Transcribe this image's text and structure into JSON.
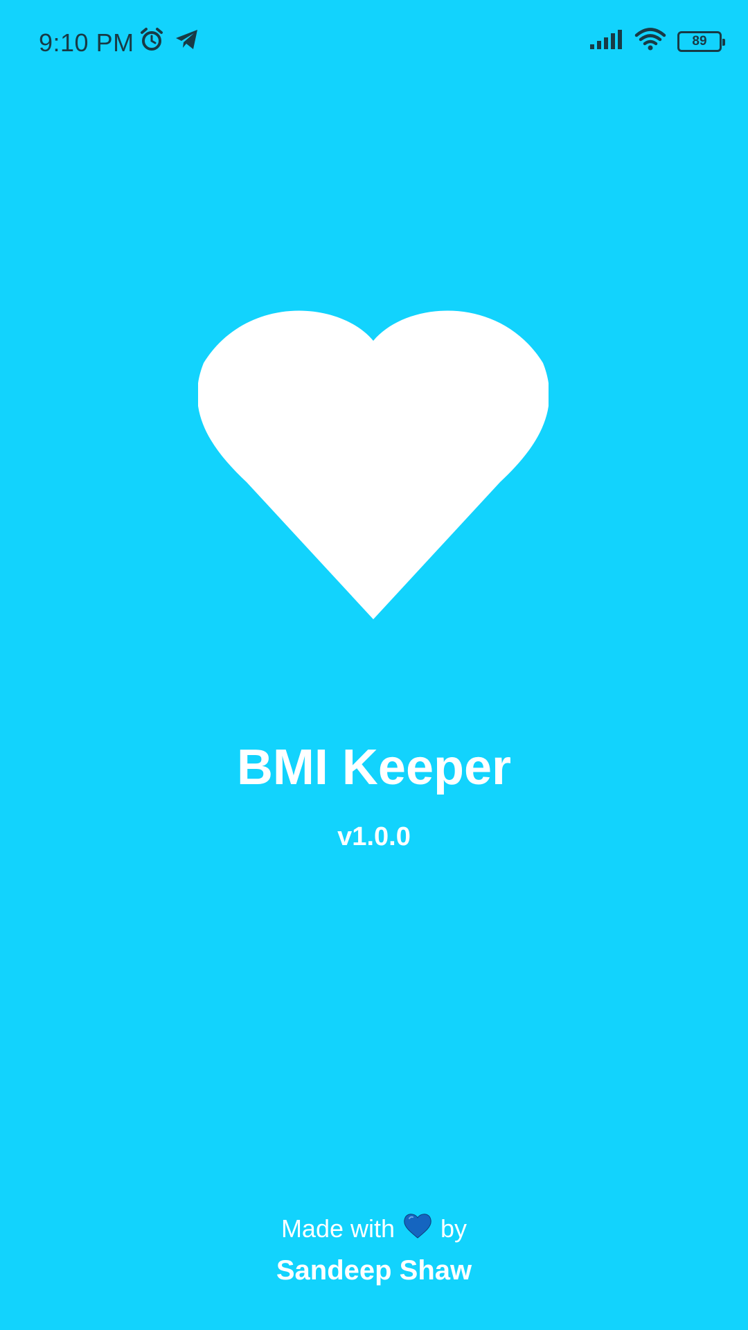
{
  "status_bar": {
    "time": "9:10 PM",
    "battery_level": "89",
    "icons": [
      "alarm-icon",
      "telegram-icon",
      "signal-icon",
      "wifi-icon",
      "battery-icon"
    ]
  },
  "app": {
    "logo_icon": "heart-icon",
    "title": "BMI Keeper",
    "version": "v1.0.0"
  },
  "credits": {
    "made_with_prefix": "Made with",
    "heart_icon": "blue-heart-icon",
    "made_with_suffix": "by",
    "author": "Sandeep Shaw"
  },
  "colors": {
    "background": "#12D3FD",
    "foreground": "#FFFFFF",
    "status_icons": "#183A45",
    "credit_heart": "#1565C0"
  }
}
